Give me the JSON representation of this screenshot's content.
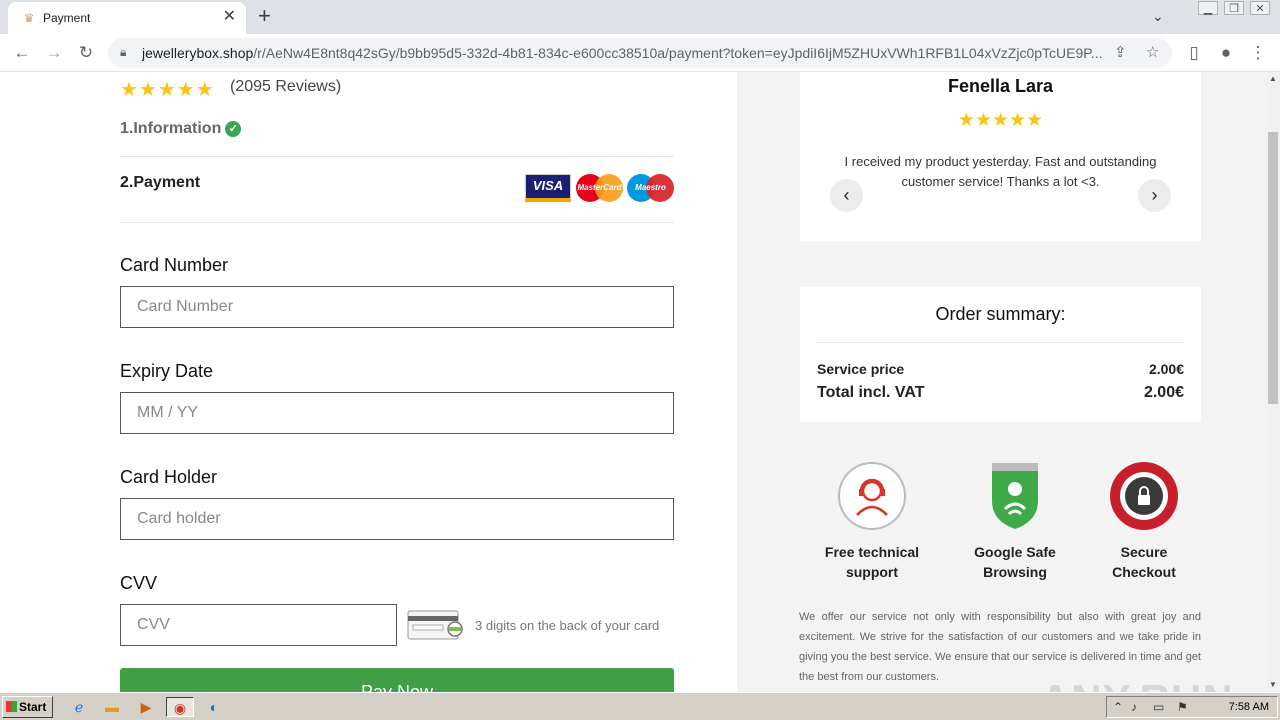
{
  "browser": {
    "tab_title": "Payment",
    "url_host": "jewellerybox.shop",
    "url_path": "/r/AeNw4E8nt8q42sGy/b9bb95d5-332d-4b81-834c-e600cc38510a/payment?token=eyJpdiI6IjM5ZHUxVWh1RFB1L04xVzZjc0pTcUE9P..."
  },
  "product": {
    "stars": "★★★★★",
    "reviews": "(2095 Reviews)"
  },
  "steps": {
    "step1": "1.Information",
    "step2": "2.Payment"
  },
  "card_logos": {
    "visa": "VISA",
    "mastercard": "MasterCard",
    "maestro": "Maestro"
  },
  "form": {
    "card_number": {
      "label": "Card Number",
      "placeholder": "Card Number"
    },
    "expiry": {
      "label": "Expiry Date",
      "placeholder": "MM / YY"
    },
    "holder": {
      "label": "Card Holder",
      "placeholder": "Card holder"
    },
    "cvv": {
      "label": "CVV",
      "placeholder": "CVV",
      "hint": "3 digits on the back of your card"
    },
    "pay_label": "Pay Now"
  },
  "review": {
    "name": "Fenella Lara",
    "stars": "★★★★★",
    "text": "I received my product yesterday. Fast and outstanding customer service! Thanks a lot <3."
  },
  "summary": {
    "title": "Order summary:",
    "service_label": "Service price",
    "service_value": "2.00€",
    "total_label": "Total incl. VAT",
    "total_value": "2.00€"
  },
  "badges": [
    {
      "line1": "Free technical",
      "line2": "support"
    },
    {
      "line1": "Google Safe",
      "line2": "Browsing"
    },
    {
      "line1": "Secure",
      "line2": "Checkout"
    }
  ],
  "about": "We offer our service not only with responsibility but also with great joy and excitement. We strive for the satisfaction of our customers and we take pride in giving you the best service. We ensure that our service is delivered in time and get the best from our customers.",
  "watermark": "ANY.RUN",
  "taskbar": {
    "start": "Start",
    "clock": "7:58 AM"
  },
  "colors": {
    "accent_green": "#3fa046",
    "star_yellow": "#f7c513",
    "check_green": "#3aa655"
  }
}
